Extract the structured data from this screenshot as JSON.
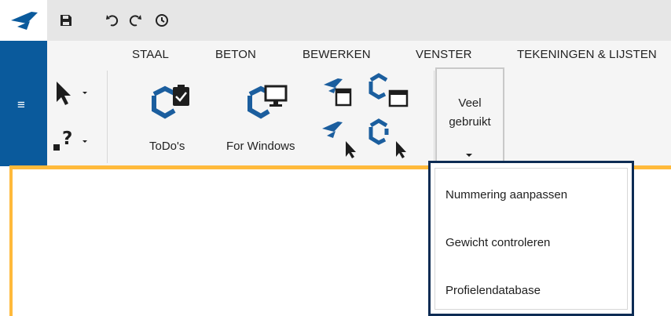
{
  "tabs": [
    {
      "label": "STAAL"
    },
    {
      "label": "BETON"
    },
    {
      "label": "BEWERKEN"
    },
    {
      "label": "VENSTER"
    },
    {
      "label": "TEKENINGEN & LIJSTEN"
    }
  ],
  "ribbon": {
    "todos_label": "ToDo's",
    "forwindows_label": "For Windows",
    "veel_line1": "Veel",
    "veel_line2": "gebruikt"
  },
  "dropdown": {
    "items": [
      {
        "label": "Nummering aanpassen"
      },
      {
        "label": "Gewicht controleren"
      },
      {
        "label": "Profielendatabase"
      }
    ]
  },
  "colors": {
    "brand_blue": "#0a5a9c",
    "orange_border": "#ffba3b",
    "dropdown_border": "#0d2c54",
    "icon_blue": "#1b5e9e"
  },
  "icons": {
    "app": "app-logo-icon",
    "save": "save-icon",
    "undo": "undo-icon",
    "redo": "redo-icon",
    "history": "history-icon",
    "menu": "hamburger-menu-icon",
    "select": "pointer-icon",
    "help": "help-icon",
    "todos": "todos-icon",
    "for_windows": "for-windows-icon"
  }
}
